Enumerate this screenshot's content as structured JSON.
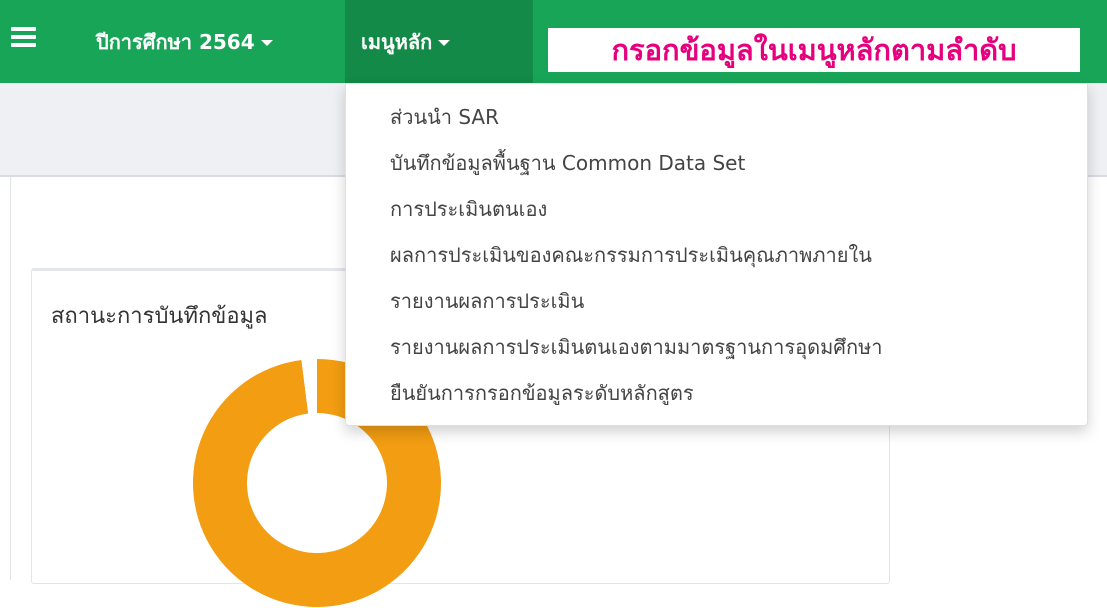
{
  "navbar": {
    "year_label": "ปีการศึกษา 2564",
    "menu_label": "เมนูหลัก",
    "instruction": "กรอกข้อมูลในเมนูหลักตามลำดับ"
  },
  "dropdown": {
    "items": [
      "ส่วนนำ SAR",
      "บันทึกข้อมูลพื้นฐาน Common Data Set",
      "การประเมินตนเอง",
      "ผลการประเมินของคณะกรรมการประเมินคุณภาพภายใน",
      "รายงานผลการประเมิน",
      "รายงานผลการประเมินตนเองตามมาตรฐานการอุดมศึกษา",
      "ยืนยันการกรอกข้อมูลระดับหลักสูตร"
    ]
  },
  "card": {
    "title": "สถานะการบันทึกข้อมูล"
  },
  "chart_data": {
    "type": "pie",
    "values": [
      0.98,
      0.02
    ],
    "colors": [
      "#f29d12",
      "#ffffff"
    ]
  },
  "colors": {
    "navbar": "#18a558",
    "navbar_active": "#138a48",
    "instruction_text": "#e6007e",
    "donut": "#f29d12"
  }
}
